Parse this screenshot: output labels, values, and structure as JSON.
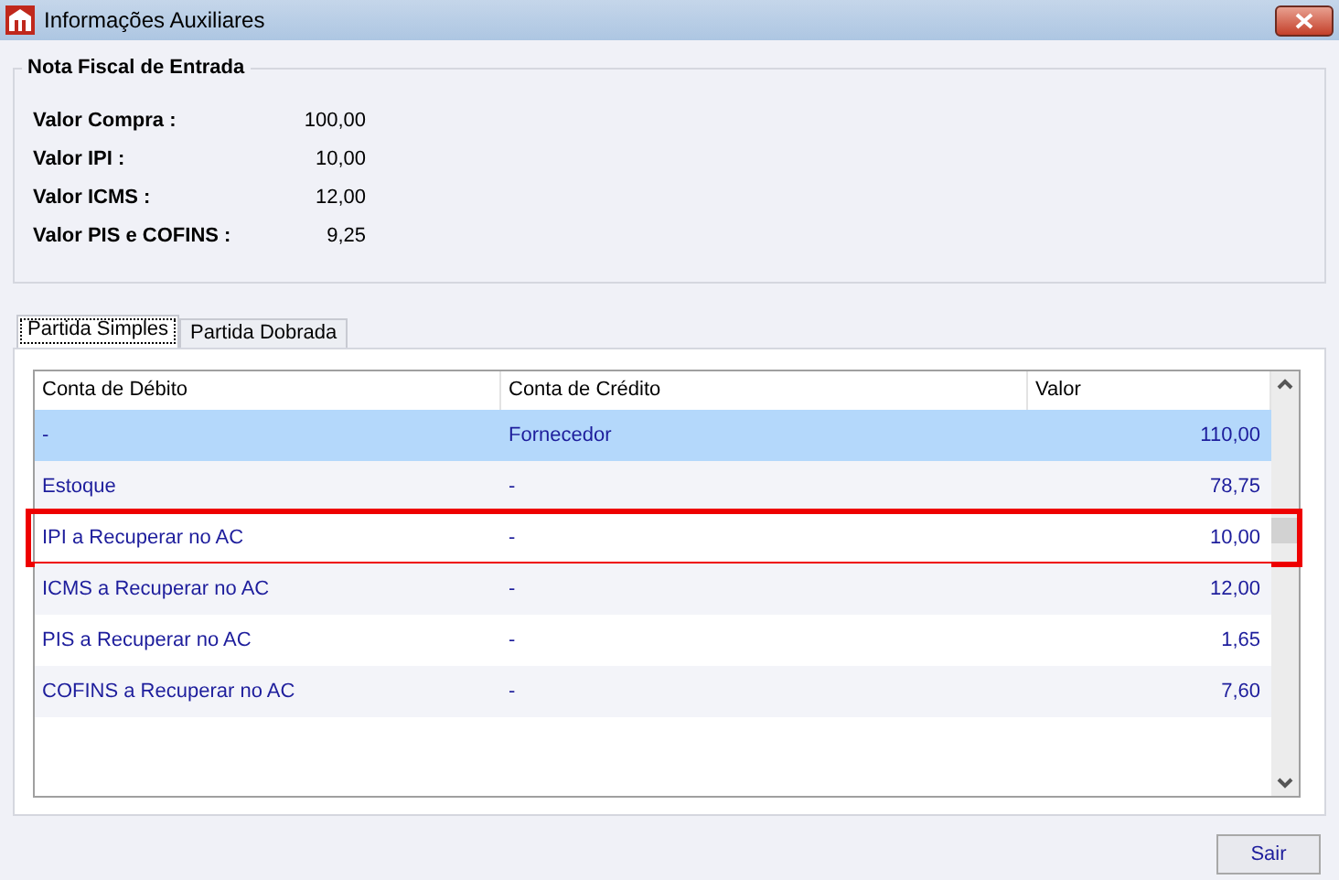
{
  "window": {
    "title": "Informações Auxiliares"
  },
  "nota_fiscal": {
    "title": "Nota Fiscal de Entrada",
    "fields": [
      {
        "label": "Valor Compra :",
        "value": "100,00"
      },
      {
        "label": "Valor IPI :",
        "value": "10,00"
      },
      {
        "label": "Valor ICMS :",
        "value": "12,00"
      },
      {
        "label": "Valor PIS e COFINS :",
        "value": "9,25"
      }
    ]
  },
  "tabs": [
    {
      "label": "Partida Simples",
      "selected": true
    },
    {
      "label": "Partida Dobrada",
      "selected": false
    }
  ],
  "table": {
    "columns": [
      "Conta de Débito",
      "Conta de Crédito",
      "Valor"
    ],
    "rows": [
      {
        "cells": [
          "-",
          "Fornecedor",
          "110,00"
        ],
        "selected": true,
        "highlighted": false
      },
      {
        "cells": [
          "Estoque",
          "-",
          "78,75"
        ],
        "selected": false,
        "highlighted": false
      },
      {
        "cells": [
          "IPI a Recuperar no AC",
          "-",
          "10,00"
        ],
        "selected": false,
        "highlighted": true
      },
      {
        "cells": [
          "ICMS a Recuperar no AC",
          "-",
          "12,00"
        ],
        "selected": false,
        "highlighted": false
      },
      {
        "cells": [
          "PIS a Recuperar no AC",
          "-",
          "1,65"
        ],
        "selected": false,
        "highlighted": false
      },
      {
        "cells": [
          "COFINS a Recuperar no AC",
          "-",
          "7,60"
        ],
        "selected": false,
        "highlighted": false
      }
    ]
  },
  "buttons": [
    {
      "label": "Sair"
    }
  ]
}
